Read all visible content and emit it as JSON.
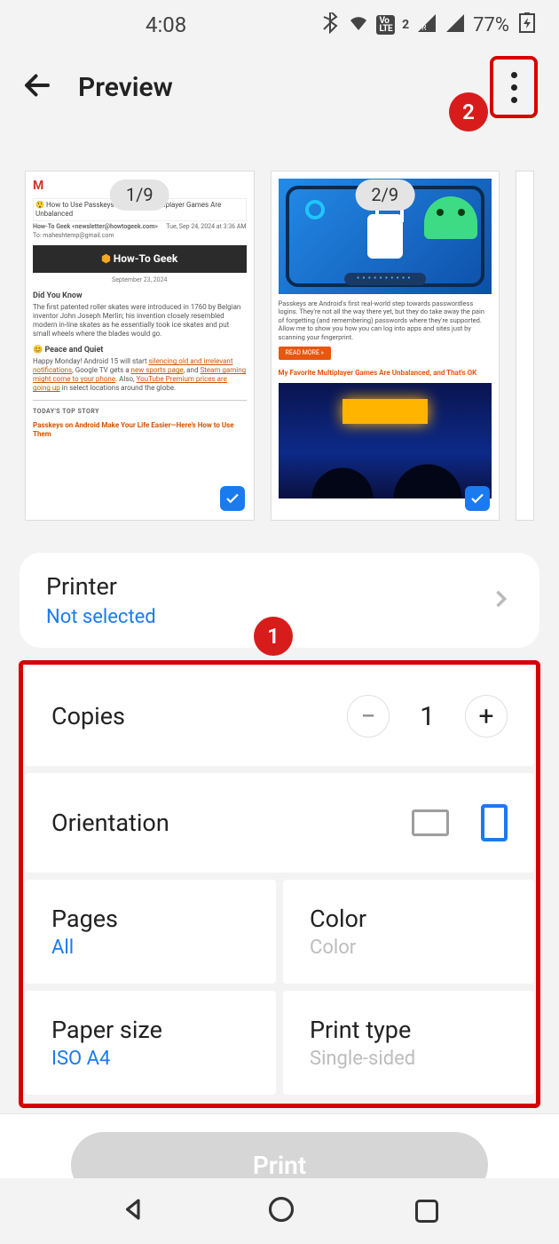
{
  "statusbar": {
    "time": "4:08",
    "battery_pct": "77%",
    "network_badge": "VoLTE2"
  },
  "appbar": {
    "title": "Preview"
  },
  "annotations": {
    "badge1": "1",
    "badge2": "2"
  },
  "thumbs": {
    "page1_badge": "1/9",
    "page2_badge": "2/9",
    "t1": {
      "subject": "😲 How to Use Passkeys on Your An… …tiplayer Games Are Unbalanced",
      "from": "How-To Geek <newsletter@howtogeek.com>",
      "to": "To: maheshtemp@gmail.com",
      "date_meta": "Tue, Sep 24, 2024 at 3:36 AM",
      "banner": "How-To Geek",
      "date": "September 23, 2024",
      "didyouknow": "Did You Know",
      "didyouknow_body": "The first patented roller skates were introduced in 1760 by Belgian inventor John Joseph Merlin; his invention closely resembled modern in-line skates as he essentially took ice skates and put small wheels where the blades would go.",
      "peace": "😊 Peace and Quiet",
      "peace_body_1": "Happy Monday! Android 15 will start ",
      "peace_link_1": "silencing old and irrelevant notifications",
      "peace_body_2": ", Google TV gets a ",
      "peace_link_2": "new sports page",
      "peace_body_3": ", and ",
      "peace_link_3": "Steam gaming might come to your phone",
      "peace_body_4": ". Also, ",
      "peace_link_4": "YouTube Premium prices are going up",
      "peace_body_5": " in select locations around the globe.",
      "topstory_hdr": "TODAY'S TOP STORY",
      "topstory": "Passkeys on Android Make Your Life Easier—Here's How to Use Them"
    },
    "t2": {
      "pwbar": "••••••••••",
      "para": "Passkeys are Android's first real-world step towards passwordless logins. They're not all the way there yet, but they do take away the pain of forgetting (and remembering) passwords where they're supported. Allow me to show you how you can log into apps and sites just by scanning your fingerprint.",
      "readmore": "READ MORE »",
      "favtitle": "My Favorite Multiplayer Games Are Unbalanced, and That's OK"
    }
  },
  "options": {
    "printer_label": "Printer",
    "printer_value": "Not selected",
    "copies_label": "Copies",
    "copies_value": "1",
    "orientation_label": "Orientation",
    "pages_label": "Pages",
    "pages_value": "All",
    "color_label": "Color",
    "color_value": "Color",
    "papersize_label": "Paper size",
    "papersize_value": "ISO A4",
    "printtype_label": "Print type",
    "printtype_value": "Single-sided"
  },
  "print_button": "Print"
}
